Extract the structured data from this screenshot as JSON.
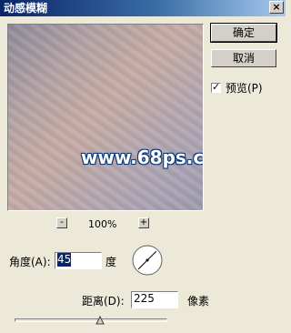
{
  "window": {
    "title": "动感模糊",
    "close_glyph": "×"
  },
  "preview": {
    "watermark": "www.68ps.com"
  },
  "buttons": {
    "ok": "确定",
    "cancel": "取消"
  },
  "preview_toggle": {
    "label": "预览(P)",
    "checked": true,
    "check_glyph": "✓"
  },
  "zoom": {
    "minus": "-",
    "plus": "+",
    "level": "100%"
  },
  "angle": {
    "label": "角度(A):",
    "value": "45",
    "unit": "度"
  },
  "distance": {
    "label": "距离(D):",
    "value": "225",
    "unit": "像素",
    "slider_fraction": 0.56
  },
  "colors": {
    "selection": "#0a246a",
    "watermark_outline": "#0a3a7a",
    "dialog_bg": "#ece9d8"
  }
}
